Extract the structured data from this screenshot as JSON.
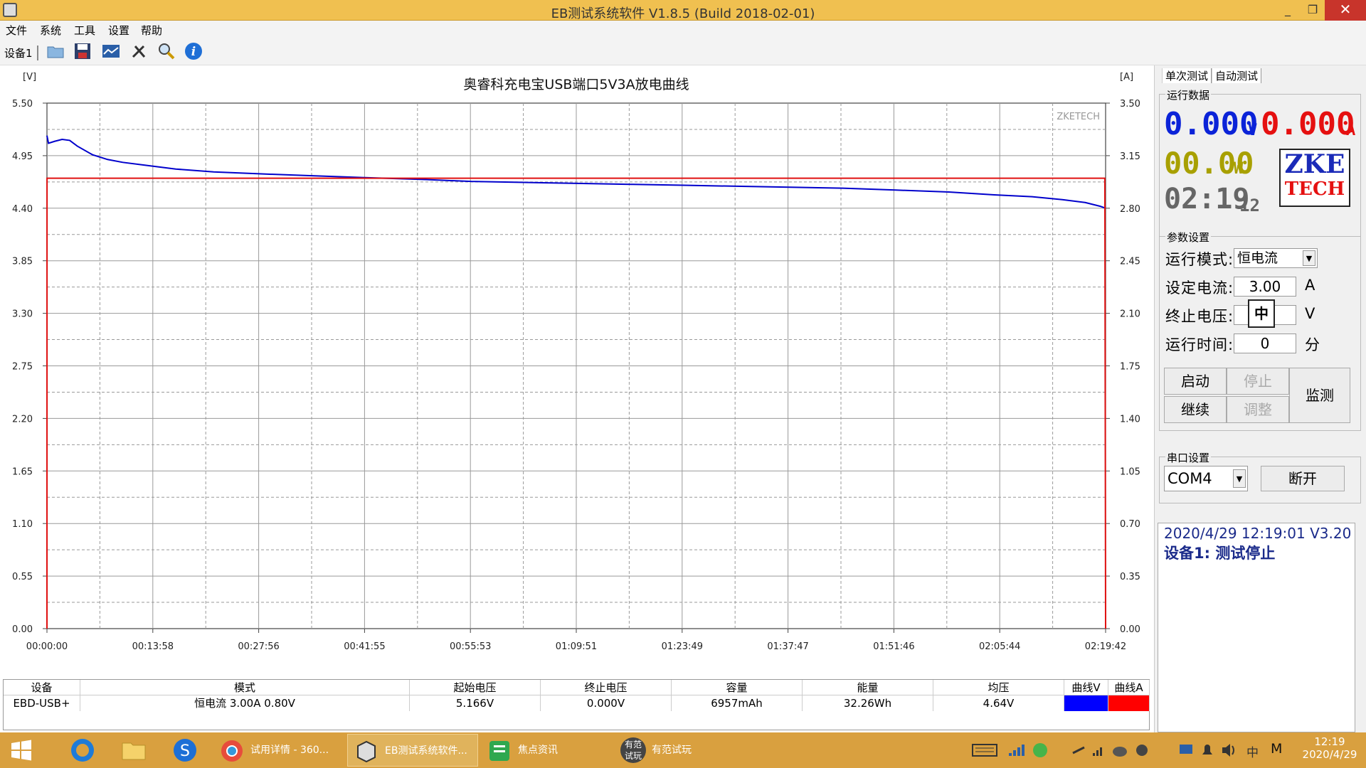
{
  "window": {
    "title": "EB测试系统软件 V1.8.5 (Build 2018-02-01)",
    "minimize": "_",
    "maximize": "❐",
    "close": "✕"
  },
  "menu": [
    "文件",
    "系统",
    "工具",
    "设置",
    "帮助"
  ],
  "toolbar": {
    "device_tab": "设备1"
  },
  "chart_data": {
    "type": "line",
    "title": "奥睿科充电宝USB端口5V3A放电曲线",
    "watermark": "ZKETECH",
    "left_unit": "[V]",
    "right_unit": "[A]",
    "y_left_ticks": [
      "5.50",
      "4.95",
      "4.40",
      "3.85",
      "3.30",
      "2.75",
      "2.20",
      "1.65",
      "1.10",
      "0.55",
      "0.00"
    ],
    "y_right_ticks": [
      "3.50",
      "3.15",
      "2.80",
      "2.45",
      "2.10",
      "1.75",
      "1.40",
      "1.05",
      "0.70",
      "0.35",
      "0.00"
    ],
    "x_ticks": [
      "00:00:00",
      "00:13:58",
      "00:27:56",
      "00:41:55",
      "00:55:53",
      "01:09:51",
      "01:23:49",
      "01:37:47",
      "01:51:46",
      "02:05:44",
      "02:19:42"
    ],
    "ylim_left": [
      0,
      5.5
    ],
    "ylim_right": [
      0,
      3.5
    ],
    "xlim_min": [
      0,
      139.7
    ],
    "grid": true,
    "series": [
      {
        "name": "曲线V",
        "axis": "left",
        "color": "#0000cc",
        "x": [
          0,
          0.2,
          1,
          2,
          3,
          4,
          6,
          8,
          10,
          13,
          17,
          22,
          28,
          35,
          42,
          50,
          56,
          63,
          70,
          77,
          84,
          91,
          98,
          105,
          112,
          119,
          125,
          130,
          134,
          137,
          139,
          139.7
        ],
        "y": [
          5.16,
          5.08,
          5.1,
          5.12,
          5.11,
          5.05,
          4.96,
          4.91,
          4.88,
          4.85,
          4.81,
          4.78,
          4.76,
          4.74,
          4.72,
          4.7,
          4.68,
          4.67,
          4.66,
          4.65,
          4.64,
          4.63,
          4.62,
          4.61,
          4.59,
          4.57,
          4.54,
          4.52,
          4.49,
          4.46,
          4.42,
          4.4
        ]
      },
      {
        "name": "曲线A",
        "axis": "right",
        "color": "#e01010",
        "x": [
          0,
          0.01,
          139.6,
          139.7
        ],
        "y": [
          0,
          3.0,
          3.0,
          0
        ]
      }
    ]
  },
  "table": {
    "headers": [
      "设备",
      "模式",
      "起始电压",
      "终止电压",
      "容量",
      "能量",
      "均压",
      "曲线V",
      "曲线A"
    ],
    "row": {
      "device": "EBD-USB+",
      "mode": "恒电流  3.00A  0.80V",
      "start_v": "5.166V",
      "end_v": "0.000V",
      "capacity": "6957mAh",
      "energy": "32.26Wh",
      "avg_v": "4.64V"
    },
    "color_v": "#0000ff",
    "color_a": "#ff0000"
  },
  "right": {
    "tabs": [
      "单次测试",
      "自动测试"
    ],
    "run_data_title": "运行数据",
    "voltage": "0.000",
    "voltage_unit": "V",
    "current": "0.000",
    "current_unit": "A",
    "power": "00.00",
    "power_unit": "W",
    "time": "02:19",
    "time_sec": "12",
    "logo_line1": "ZKE",
    "logo_line2": "TECH",
    "params_title": "参数设置",
    "mode_label": "运行模式:",
    "mode_value": "恒电流",
    "set_current_label": "设定电流:",
    "set_current_value": "3.00",
    "set_current_unit": "A",
    "end_voltage_label": "终止电压:",
    "end_voltage_value": "中",
    "end_voltage_unit": "V",
    "run_time_label": "运行时间:",
    "run_time_value": "0",
    "run_time_unit": "分",
    "btn_start": "启动",
    "btn_stop": "停止",
    "btn_monitor": "监测",
    "btn_continue": "继续",
    "btn_adjust": "调整",
    "serial_title": "串口设置",
    "com_value": "COM4",
    "btn_disconnect": "断开",
    "status_line1": "2020/4/29 12:19:01  V3.20",
    "status_line2": "设备1: 测试停止"
  },
  "taskbar": {
    "tasks": [
      "试用详情 - 360...",
      "EB测试系统软件...",
      "焦点资讯",
      "有范试玩"
    ],
    "icon_label": "有范\n试玩",
    "ime": "中",
    "ime2": "M",
    "time": "12:19",
    "date": "2020/4/29"
  }
}
